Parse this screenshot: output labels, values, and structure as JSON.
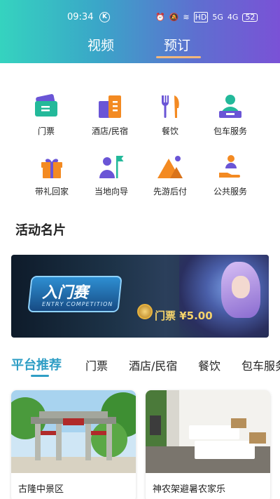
{
  "status_bar": {
    "time": "09:34",
    "k_badge": "K",
    "hd": "HD",
    "signal_1": "5G",
    "signal_2": "4G",
    "battery": "52"
  },
  "tabs": {
    "video": "视频",
    "booking": "预订"
  },
  "services": [
    {
      "label": "门票",
      "icon": "ticket-icon"
    },
    {
      "label": "酒店/民宿",
      "icon": "hotel-icon"
    },
    {
      "label": "餐饮",
      "icon": "cutlery-icon"
    },
    {
      "label": "包车服务",
      "icon": "chauffeur-icon"
    },
    {
      "label": "带礼回家",
      "icon": "gift-icon"
    },
    {
      "label": "当地向导",
      "icon": "guide-icon"
    },
    {
      "label": "先游后付",
      "icon": "mountain-icon"
    },
    {
      "label": "公共服务",
      "icon": "public-service-icon"
    }
  ],
  "section": {
    "title": "活动名片"
  },
  "banner": {
    "logo_text": "入门赛",
    "logo_sub": "ENTRY COMPETITION",
    "price_text": "门票 ¥5.00"
  },
  "categories": [
    "平台推荐",
    "门票",
    "酒店/民宿",
    "餐饮",
    "包车服务"
  ],
  "cards": [
    {
      "title": "古隆中景区"
    },
    {
      "title": "神农架避暑农家乐"
    }
  ],
  "colors": {
    "accent": "#2f9ec5",
    "tab_underline": "#f2b77b",
    "icon_purple": "#6a55d6",
    "icon_orange": "#f38a22",
    "icon_green": "#23b99a"
  }
}
